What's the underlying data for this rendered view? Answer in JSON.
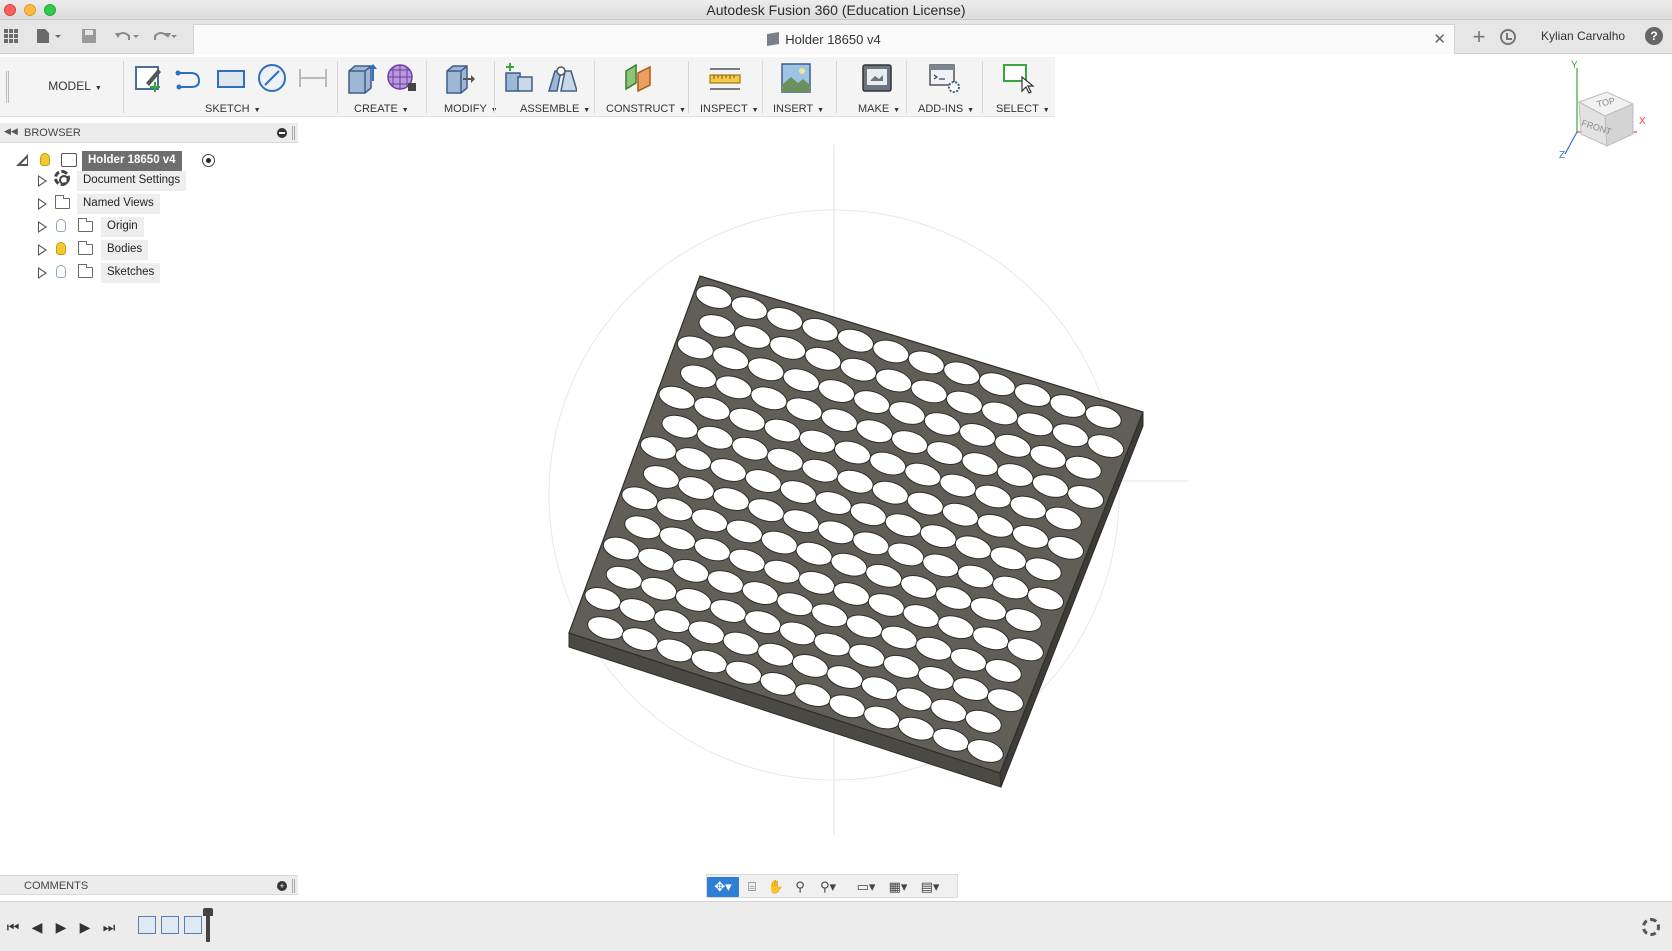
{
  "app": {
    "title": "Autodesk Fusion 360 (Education License)",
    "user": "Kylian Carvalho"
  },
  "document_tab": {
    "title": "Holder 18650 v4"
  },
  "toolbar": {
    "workspace": "MODEL",
    "groups": [
      {
        "label": "SKETCH"
      },
      {
        "label": "CREATE"
      },
      {
        "label": "MODIFY"
      },
      {
        "label": "ASSEMBLE"
      },
      {
        "label": "CONSTRUCT"
      },
      {
        "label": "INSPECT"
      },
      {
        "label": "INSERT"
      },
      {
        "label": "MAKE"
      },
      {
        "label": "ADD-INS"
      },
      {
        "label": "SELECT"
      }
    ]
  },
  "browser": {
    "title": "BROWSER",
    "root": "Holder 18650 v4",
    "items": [
      {
        "label": "Document Settings",
        "icon": "gear-icon"
      },
      {
        "label": "Named Views",
        "icon": "folder-icon"
      },
      {
        "label": "Origin",
        "icon": "folder-icon",
        "visible": false
      },
      {
        "label": "Bodies",
        "icon": "folder-icon",
        "visible": true
      },
      {
        "label": "Sketches",
        "icon": "folder-icon",
        "visible": false
      }
    ]
  },
  "comments": {
    "title": "COMMENTS"
  },
  "viewcube": {
    "top": "TOP",
    "front": "FRONT",
    "axes": [
      "X",
      "Y",
      "Z"
    ]
  },
  "model": {
    "name": "Holder 18650 v4",
    "hole_rows": 14,
    "hole_cols": 12,
    "plate_color": "#5f5d56",
    "hole_color": "#ffffff"
  },
  "colors": {
    "accent": "#2f7fd6",
    "bulb_on": "#f2c833",
    "axis_x": "#e64545",
    "axis_y": "#3aa640",
    "axis_z": "#3a6bd6"
  }
}
